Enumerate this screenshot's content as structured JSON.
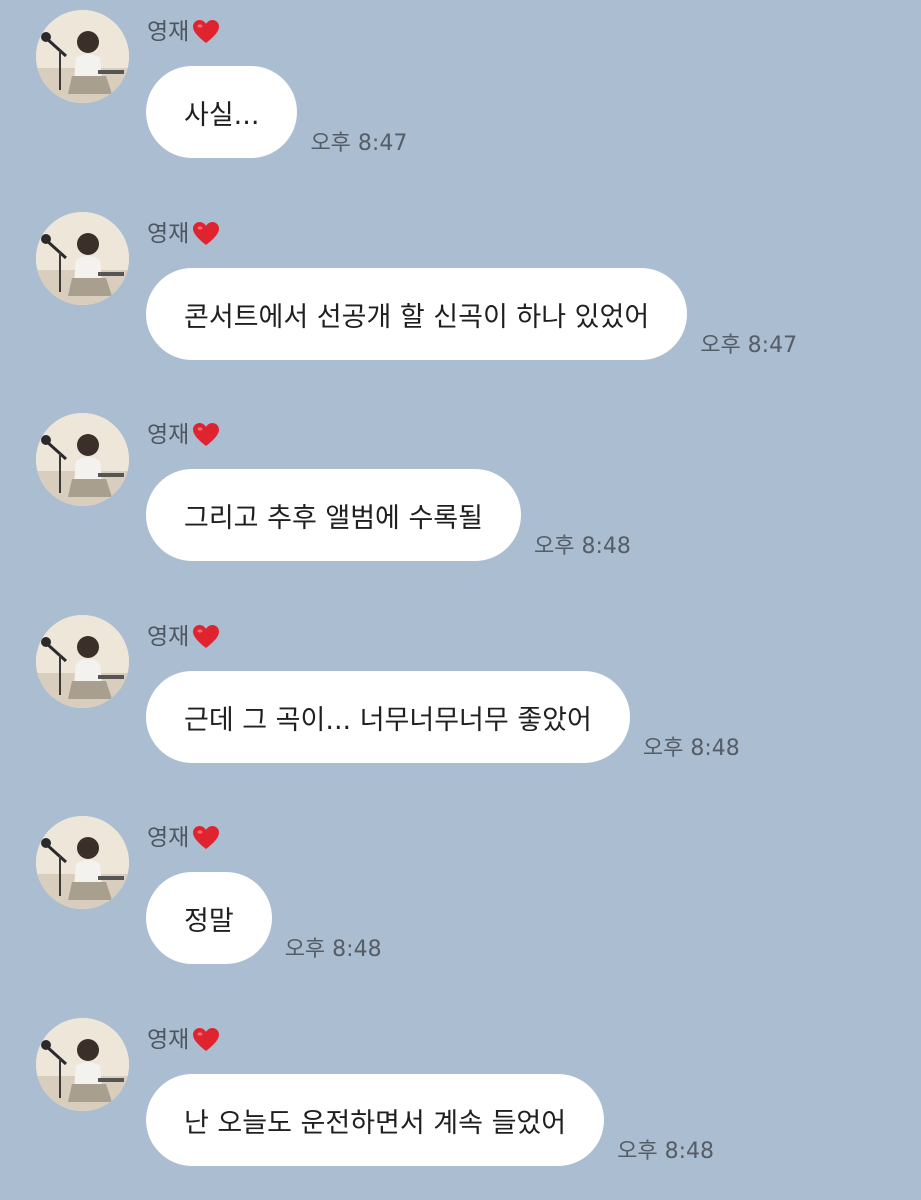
{
  "chat": {
    "messages": [
      {
        "sender": "영재",
        "text": "사실...",
        "time": "오후 8:47"
      },
      {
        "sender": "영재",
        "text": "콘서트에서 선공개 할 신곡이 하나 있었어",
        "time": "오후 8:47"
      },
      {
        "sender": "영재",
        "text": "그리고 추후 앨범에 수록될",
        "time": "오후 8:48"
      },
      {
        "sender": "영재",
        "text": "근데 그 곡이... 너무너무너무 좋았어",
        "time": "오후 8:48"
      },
      {
        "sender": "영재",
        "text": "정말",
        "time": "오후 8:48"
      },
      {
        "sender": "영재",
        "text": "난 오늘도 운전하면서 계속 들었어",
        "time": "오후 8:48"
      }
    ]
  },
  "icons": {
    "sender_badge": "heart-icon",
    "avatar": "profile-photo"
  },
  "colors": {
    "background": "#abbdd0",
    "bubble": "#ffffff",
    "heart": "#e0242f"
  }
}
